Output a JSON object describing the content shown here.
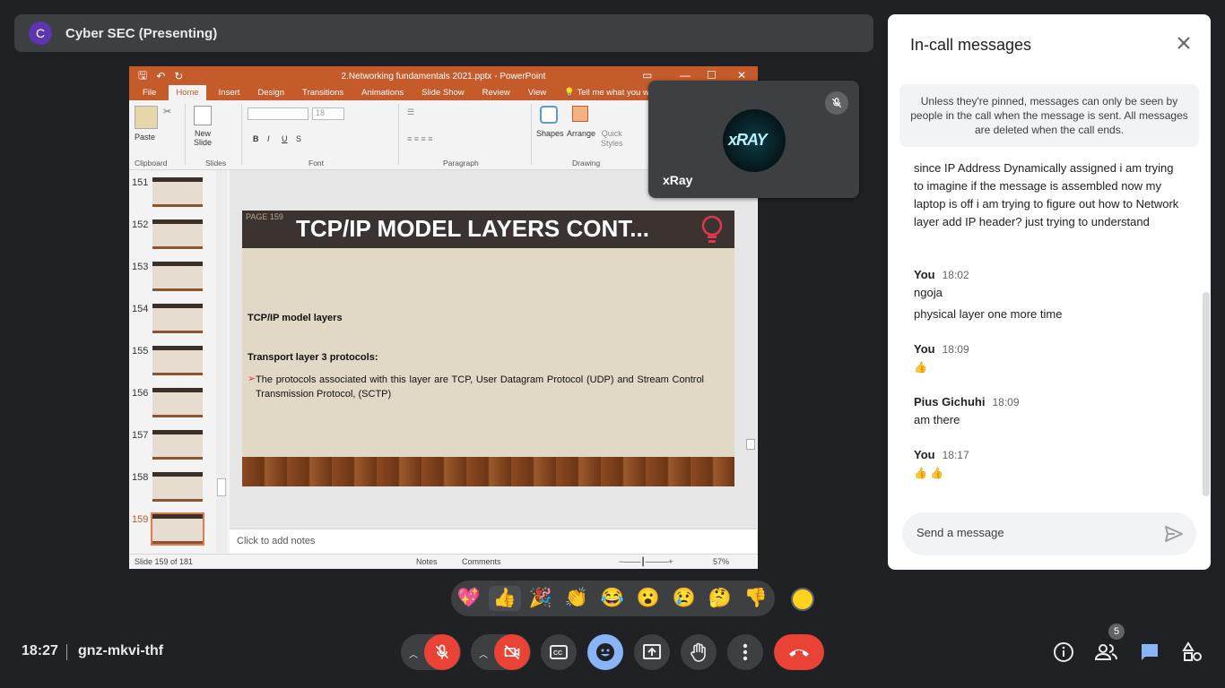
{
  "presenter": {
    "initial": "C",
    "name": "Cyber SEC (Presenting)"
  },
  "powerpoint": {
    "filename": "2.Networking fundamentals 2021.pptx - PowerPoint",
    "menu_tabs": [
      "File",
      "Home",
      "Insert",
      "Design",
      "Transitions",
      "Animations",
      "Slide Show",
      "Review",
      "View"
    ],
    "tell_me": "Tell me what you w",
    "ribbon": {
      "paste": "Paste",
      "new_slide": "New\nSlide",
      "font_size": "18",
      "shapes": "Shapes",
      "arrange": "Arrange",
      "quick_styles": "Quick\nStyles",
      "groups": [
        "Clipboard",
        "Slides",
        "Font",
        "Paragraph",
        "Drawing"
      ]
    },
    "thumbnails": [
      "151",
      "152",
      "153",
      "154",
      "155",
      "156",
      "157",
      "158",
      "159"
    ],
    "selected_thumbnail": "159",
    "slide": {
      "page": "PAGE 159",
      "title": "TCP/IP MODEL LAYERS CONT...",
      "heading1": "TCP/IP model layers",
      "heading2": "Transport layer 3 protocols:",
      "bullet": "The protocols associated with this layer are TCP, User Datagram Protocol (UDP) and Stream Control Transmission Protocol, (SCTP)"
    },
    "notes_placeholder": "Click to add notes",
    "status": {
      "slide_count": "Slide 159 of 181",
      "notes": "Notes",
      "comments": "Comments",
      "zoom": "57%"
    }
  },
  "video_tile": {
    "name": "xRay",
    "avatar_label": "xRAY"
  },
  "chat": {
    "title": "In-call messages",
    "notice": "Unless they're pinned, messages can only be seen by people in the call when the message is sent. All messages are deleted when the call ends.",
    "first_message": "since IP Address Dynamically assigned i am trying to imagine if the message is assembled now my laptop is off i am trying to figure out how to Network layer add IP header? just trying to understand",
    "groups": [
      {
        "sender": "You",
        "time": "18:02",
        "messages": [
          "ngoja",
          "physical layer one more time"
        ]
      },
      {
        "sender": "You",
        "time": "18:09",
        "messages": [
          "👍"
        ]
      },
      {
        "sender": "Pius Gichuhi",
        "time": "18:09",
        "messages": [
          "am there"
        ]
      },
      {
        "sender": "You",
        "time": "18:17",
        "messages": [
          "👍 👍"
        ]
      }
    ],
    "input_placeholder": "Send a message"
  },
  "reactions": [
    "💖",
    "👍",
    "🎉",
    "👏",
    "😂",
    "😮",
    "😢",
    "🤔",
    "👎"
  ],
  "bottom_bar": {
    "time": "18:27",
    "meeting_code": "gnz-mkvi-thf",
    "participant_count": "5"
  },
  "colors": {
    "accent_red": "#ea4335",
    "ppt_orange": "#c55a2b",
    "reaction_active": "#8ab4f8",
    "chat_blue": "#8ab4f8"
  }
}
